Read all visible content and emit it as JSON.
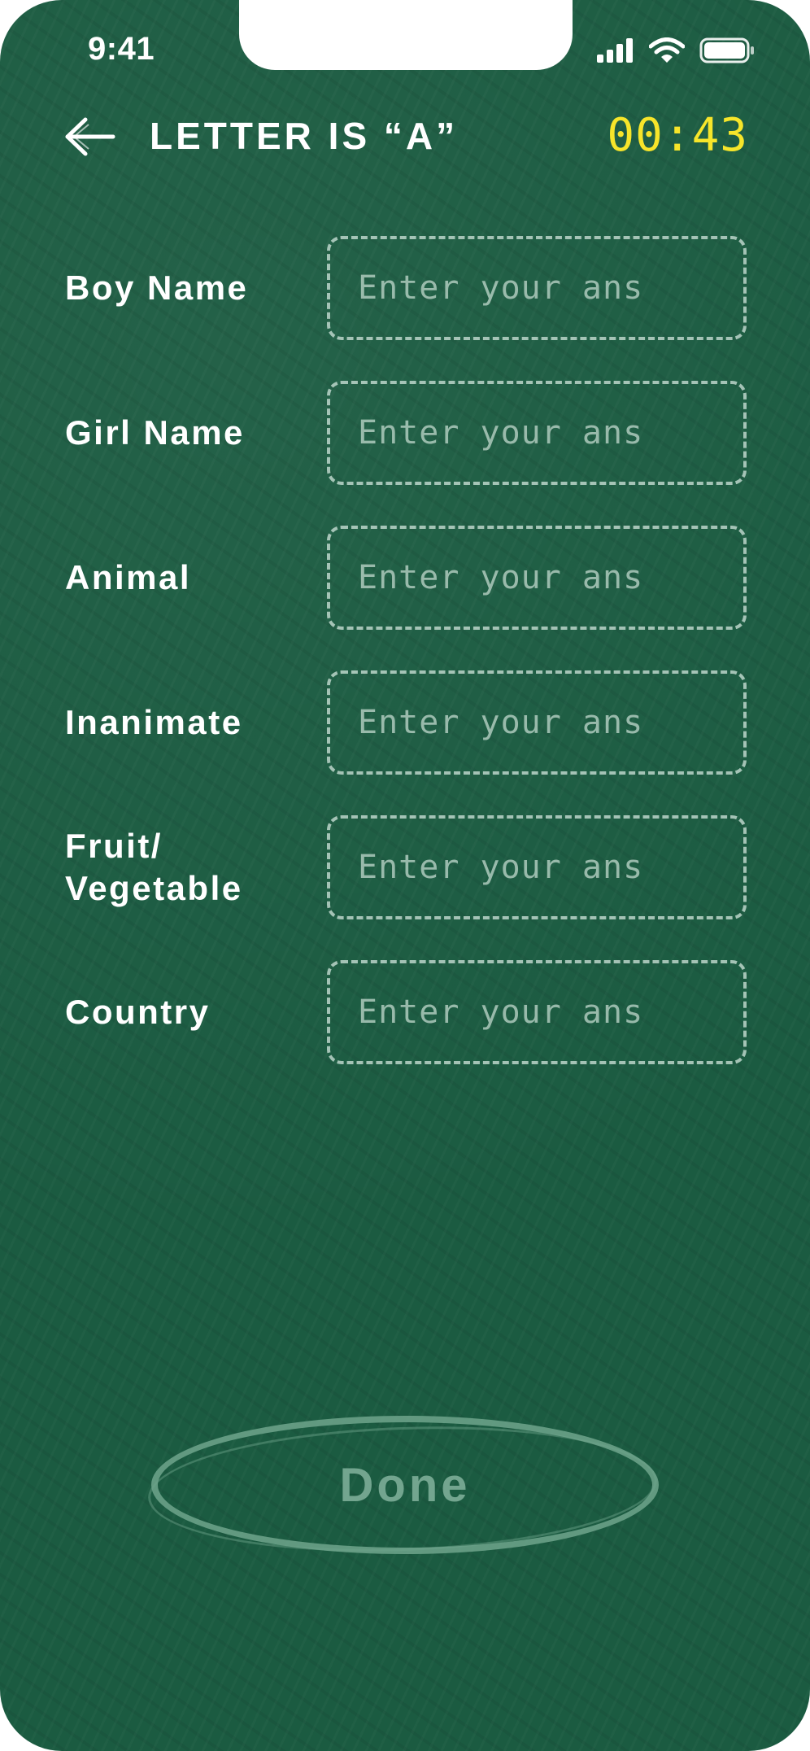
{
  "status_bar": {
    "time": "9:41",
    "icons": [
      "signal-icon",
      "wifi-icon",
      "battery-icon"
    ]
  },
  "header": {
    "title": "LETTER IS “A”",
    "timer": "00:43",
    "back_icon": "back-arrow-icon"
  },
  "form": {
    "fields": [
      {
        "label": "Boy Name",
        "placeholder": "Enter your ans",
        "value": ""
      },
      {
        "label": "Girl Name",
        "placeholder": "Enter your ans",
        "value": ""
      },
      {
        "label": "Animal",
        "placeholder": "Enter your ans",
        "value": ""
      },
      {
        "label": "Inanimate",
        "placeholder": "Enter your ans",
        "value": ""
      },
      {
        "label": "Fruit/ Vegetable",
        "placeholder": "Enter your ans",
        "value": ""
      },
      {
        "label": "Country",
        "placeholder": "Enter your ans",
        "value": ""
      }
    ]
  },
  "actions": {
    "done_label": "Done"
  },
  "colors": {
    "board_green": "#1b5b41",
    "timer_yellow": "#f7e52a",
    "chalk_white": "#ffffff",
    "disabled_green": "#78aa94"
  }
}
